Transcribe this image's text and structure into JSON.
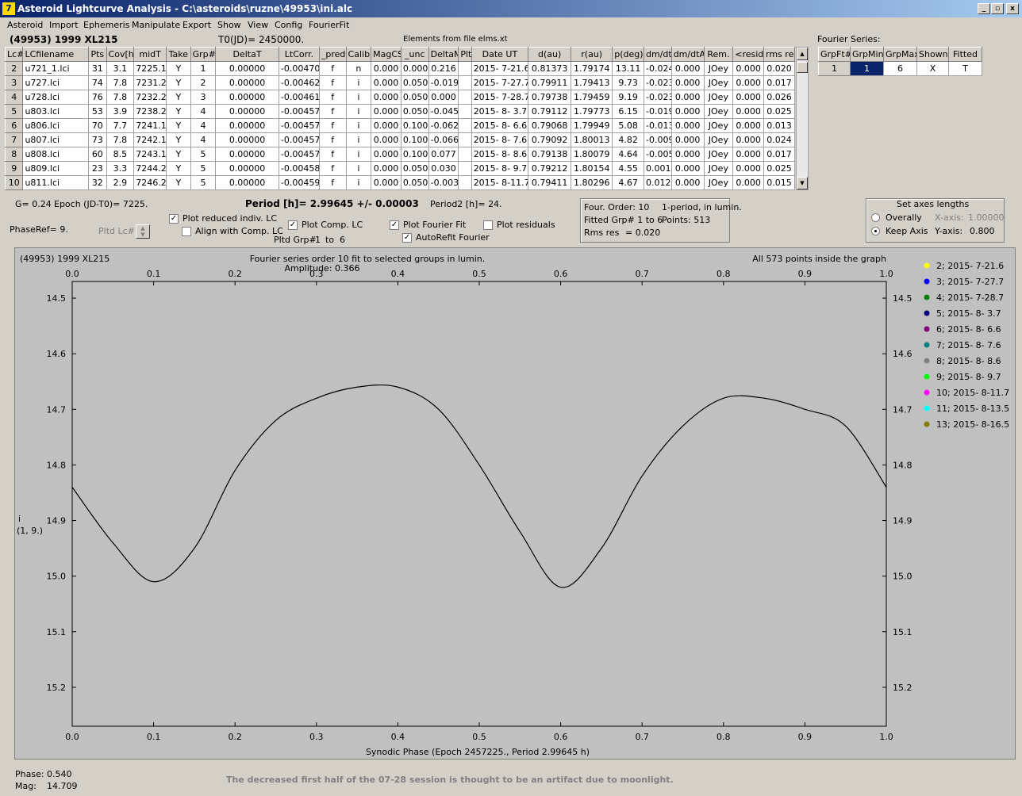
{
  "window": {
    "title": "Asteroid Lightcurve Analysis - C:\\asteroids\\ruzne\\49953\\ini.alc"
  },
  "menu": [
    "Asteroid",
    "Import",
    "Ephemeris",
    "Manipulate",
    "Export",
    "Show",
    "View",
    "Config",
    "FourierFit"
  ],
  "header": {
    "asteroid": "(49953) 1999 XL215",
    "t0": "T0(JD)= 2450000.",
    "elements": "Elements from file elms.xt"
  },
  "table": {
    "columns": [
      "Lc#",
      "LCfilename",
      "Pts",
      "Cov[h]",
      "midT",
      "Take",
      "Grp#",
      "DeltaT",
      "LtCorr.",
      "_pred.",
      "Calib.",
      "MagCS",
      "_unc",
      "DeltaM",
      "Plt",
      "Date UT",
      "d(au)",
      "r(au)",
      "p(deg)",
      "dm/dt",
      "dm/dtA",
      "Rem.",
      "<resid>",
      "rms res"
    ],
    "rows": [
      [
        "2",
        "u721_1.lci",
        "31",
        "3.1",
        "7225.1",
        "Y",
        "1",
        "0.00000",
        "-0.00470",
        "f",
        "n",
        "0.000",
        "0.000",
        "0.216",
        "",
        "2015- 7-21.6",
        "0.81373",
        "1.79174",
        "13.11",
        "-0.024",
        "0.000",
        "JOey",
        "0.000",
        "0.020"
      ],
      [
        "3",
        "u727.lci",
        "74",
        "7.8",
        "7231.2",
        "Y",
        "2",
        "0.00000",
        "-0.00462",
        "f",
        "i",
        "0.000",
        "0.050",
        "-0.019",
        "",
        "2015- 7-27.7",
        "0.79911",
        "1.79413",
        "9.73",
        "-0.023",
        "0.000",
        "JOey",
        "0.000",
        "0.017"
      ],
      [
        "4",
        "u728.lci",
        "76",
        "7.8",
        "7232.2",
        "Y",
        "3",
        "0.00000",
        "-0.00461",
        "f",
        "i",
        "0.000",
        "0.050",
        "0.000",
        "",
        "2015- 7-28.7",
        "0.79738",
        "1.79459",
        "9.19",
        "-0.023",
        "0.000",
        "JOey",
        "0.000",
        "0.026"
      ],
      [
        "5",
        "u803.lci",
        "53",
        "3.9",
        "7238.2",
        "Y",
        "4",
        "0.00000",
        "-0.00457",
        "f",
        "i",
        "0.000",
        "0.050",
        "-0.045",
        "",
        "2015- 8- 3.7",
        "0.79112",
        "1.79773",
        "6.15",
        "-0.019",
        "0.000",
        "JOey",
        "0.000",
        "0.025"
      ],
      [
        "6",
        "u806.lci",
        "70",
        "7.7",
        "7241.1",
        "Y",
        "4",
        "0.00000",
        "-0.00457",
        "f",
        "i",
        "0.000",
        "0.100",
        "-0.062",
        "",
        "2015- 8- 6.6",
        "0.79068",
        "1.79949",
        "5.08",
        "-0.013",
        "0.000",
        "JOey",
        "0.000",
        "0.013"
      ],
      [
        "7",
        "u807.lci",
        "73",
        "7.8",
        "7242.1",
        "Y",
        "4",
        "0.00000",
        "-0.00457",
        "f",
        "i",
        "0.000",
        "0.100",
        "-0.066",
        "",
        "2015- 8- 7.6",
        "0.79092",
        "1.80013",
        "4.82",
        "-0.009",
        "0.000",
        "JOey",
        "0.000",
        "0.024"
      ],
      [
        "8",
        "u808.lci",
        "60",
        "8.5",
        "7243.1",
        "Y",
        "5",
        "0.00000",
        "-0.00457",
        "f",
        "i",
        "0.000",
        "0.100",
        "0.077",
        "",
        "2015- 8- 8.6",
        "0.79138",
        "1.80079",
        "4.64",
        "-0.005",
        "0.000",
        "JOey",
        "0.000",
        "0.017"
      ],
      [
        "9",
        "u809.lci",
        "23",
        "3.3",
        "7244.2",
        "Y",
        "5",
        "0.00000",
        "-0.00458",
        "f",
        "i",
        "0.000",
        "0.050",
        "0.030",
        "",
        "2015- 8- 9.7",
        "0.79212",
        "1.80154",
        "4.55",
        "0.001",
        "0.000",
        "JOey",
        "0.000",
        "0.025"
      ],
      [
        "10",
        "u811.lci",
        "32",
        "2.9",
        "7246.2",
        "Y",
        "5",
        "0.00000",
        "-0.00459",
        "f",
        "i",
        "0.000",
        "0.050",
        "-0.003",
        "",
        "2015- 8-11.7",
        "0.79411",
        "1.80296",
        "4.67",
        "0.012",
        "0.000",
        "JOey",
        "0.000",
        "0.015"
      ]
    ]
  },
  "fourier": {
    "title": "Fourier Series:",
    "columns": [
      "GrpFt#",
      "GrpMin",
      "GrpMax",
      "Shown",
      "Fitted"
    ],
    "row": [
      "1",
      "1",
      "6",
      "X",
      "T"
    ]
  },
  "params": {
    "g": "G= 0.24",
    "epoch": "Epoch (JD-T0)= 7225.",
    "period": "Period [h]= 2.99645 +/- 0.00003",
    "period2": "Period2 [h]= 24.",
    "phaseref": "PhaseRef= 9.",
    "pltd_lc": "Pltd Lc#:"
  },
  "options": {
    "plot_reduced": "Plot reduced indiv. LC",
    "align": "Align with Comp. LC",
    "plot_comp": "Plot Comp. LC",
    "pltd_grp": "Pltd Grp#",
    "grp_from": "1",
    "grp_to_lbl": "to",
    "grp_to": "6",
    "plot_fourier": "Plot Fourier Fit",
    "autorefit": "AutoRefit Fourier",
    "plot_residuals": "Plot residuals"
  },
  "fitinfo": {
    "order": "Four. Order: 10",
    "mode": "1-period, in lumin.",
    "fitted": "Fitted Grp# 1 to 6",
    "points": "Points: 513",
    "rms_label": "Rms res",
    "rms": "= 0.020"
  },
  "axes": {
    "title": "Set axes lengths",
    "overally": "Overally",
    "keep": "Keep Axis",
    "xaxis_lbl": "X-axis:",
    "xaxis": "1.00000",
    "yaxis_lbl": "Y-axis:",
    "yaxis": "0.800"
  },
  "plot": {
    "name": "(49953) 1999 XL215",
    "subtitle": "Fourier series order 10 fit to selected groups in lumin.",
    "amplitude": "Amplitude: 0.366",
    "points_note": "All 573 points inside the graph",
    "ylabel1": "i",
    "ylabel2": "(1, 9.)",
    "xlabel": "Synodic Phase (Epoch 2457225., Period 2.99645 h)"
  },
  "footer": {
    "phase_lbl": "Phase:",
    "phase": "0.540",
    "mag_lbl": "Mag:",
    "mag": "14.709",
    "note": "The decreased first half of the 07-28 session is thought to be an artifact due to moonlight."
  },
  "chart_data": {
    "type": "scatter",
    "xlim": [
      0,
      1
    ],
    "ylim": [
      15.27,
      14.47
    ],
    "xticks": [
      "0.0",
      "0.1",
      "0.2",
      "0.3",
      "0.4",
      "0.5",
      "0.6",
      "0.7",
      "0.8",
      "0.9",
      "1.0"
    ],
    "yticks": [
      "14.5",
      "14.6",
      "14.7",
      "14.8",
      "14.9",
      "15.0",
      "15.1",
      "15.2"
    ],
    "fit_curve": [
      [
        0,
        14.84
      ],
      [
        0.05,
        14.94
      ],
      [
        0.1,
        15.01
      ],
      [
        0.15,
        14.95
      ],
      [
        0.2,
        14.81
      ],
      [
        0.25,
        14.72
      ],
      [
        0.3,
        14.68
      ],
      [
        0.35,
        14.66
      ],
      [
        0.4,
        14.66
      ],
      [
        0.45,
        14.7
      ],
      [
        0.5,
        14.8
      ],
      [
        0.55,
        14.92
      ],
      [
        0.6,
        15.02
      ],
      [
        0.65,
        14.95
      ],
      [
        0.7,
        14.82
      ],
      [
        0.75,
        14.73
      ],
      [
        0.8,
        14.68
      ],
      [
        0.85,
        14.68
      ],
      [
        0.9,
        14.7
      ],
      [
        0.95,
        14.73
      ],
      [
        1.0,
        14.84
      ]
    ],
    "legend": [
      {
        "label": "2; 2015- 7-21.6",
        "color": "#ffff00"
      },
      {
        "label": "3; 2015- 7-27.7",
        "color": "#0000ff"
      },
      {
        "label": "4; 2015- 7-28.7",
        "color": "#008000"
      },
      {
        "label": "5; 2015- 8- 3.7",
        "color": "#000080"
      },
      {
        "label": "6; 2015- 8- 6.6",
        "color": "#800080"
      },
      {
        "label": "7; 2015- 8- 7.6",
        "color": "#008080"
      },
      {
        "label": "8; 2015- 8- 8.6",
        "color": "#808080"
      },
      {
        "label": "9; 2015- 8- 9.7",
        "color": "#00ff00"
      },
      {
        "label": "10; 2015- 8-11.7",
        "color": "#ff00ff"
      },
      {
        "label": "11; 2015- 8-13.5",
        "color": "#00ffff"
      },
      {
        "label": "13; 2015- 8-16.5",
        "color": "#808000"
      }
    ]
  }
}
